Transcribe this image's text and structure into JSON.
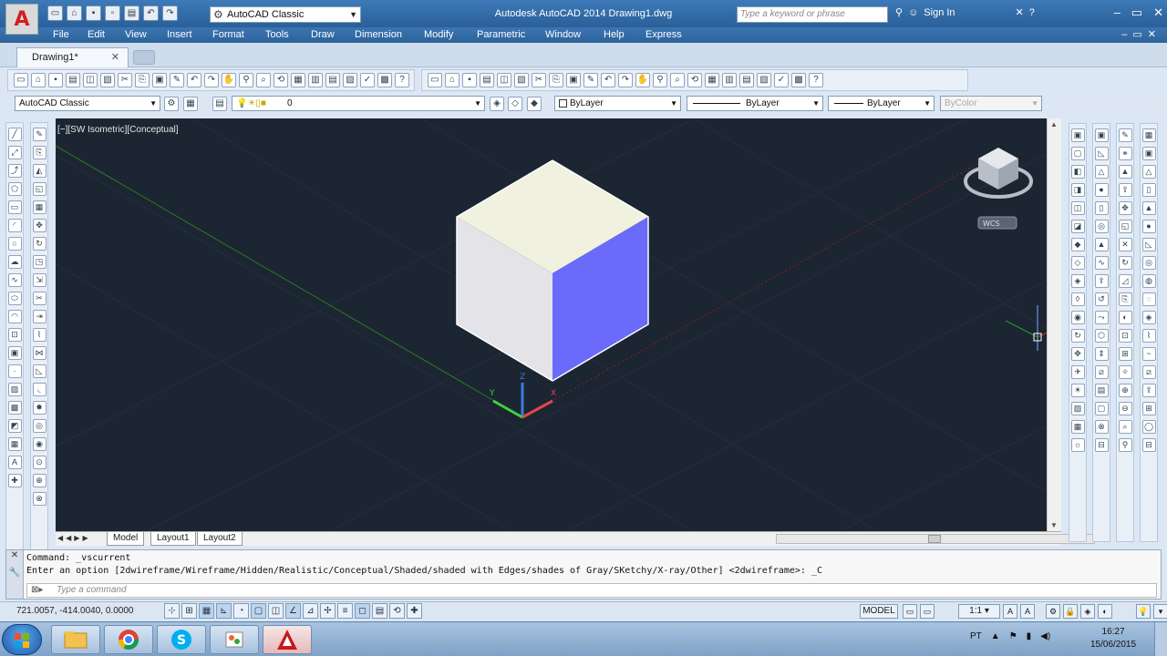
{
  "window": {
    "title": "Autodesk AutoCAD 2014    Drawing1.dwg",
    "workspace": "AutoCAD Classic",
    "search_placeholder": "Type a keyword or phrase",
    "sign_in": "Sign In"
  },
  "menu": [
    "File",
    "Edit",
    "View",
    "Insert",
    "Format",
    "Tools",
    "Draw",
    "Dimension",
    "Modify",
    "Parametric",
    "Window",
    "Help",
    "Express"
  ],
  "tabs": {
    "document": "Drawing1*"
  },
  "toolbar": {
    "workspace_dropdown": "AutoCAD Classic",
    "layer_dropdown": "0",
    "color_dropdown": "ByLayer",
    "linetype_dropdown": "ByLayer",
    "lineweight_dropdown": "ByLayer",
    "plotstyle_dropdown": "ByColor"
  },
  "viewport": {
    "label": "[−][SW Isometric][Conceptual]",
    "wcs_label": "WCS",
    "ucs_labels": {
      "x": "X",
      "y": "Y",
      "z": "Z"
    },
    "cube_top_color": "#f1f1df",
    "cube_left_color": "#e3e3e8",
    "cube_right_color": "#6a6bfb",
    "background_color": "#1c2532"
  },
  "layout_tabs": [
    "Model",
    "Layout1",
    "Layout2"
  ],
  "command": {
    "history_1": "Command: _vscurrent",
    "history_2": "Enter an option [2dwireframe/Wireframe/Hidden/Realistic/Conceptual/Shaded/shaded with Edges/shades of Gray/SKetchy/X-ray/Other] <2dwireframe>: _C",
    "input_placeholder": "Type a command"
  },
  "status": {
    "coordinates": "721.0057, -414.0040, 0.0000",
    "model_button": "MODEL",
    "annotation_scale": "1:1"
  },
  "taskbar": {
    "language": "PT",
    "time": "16:27",
    "date": "15/06/2015"
  }
}
